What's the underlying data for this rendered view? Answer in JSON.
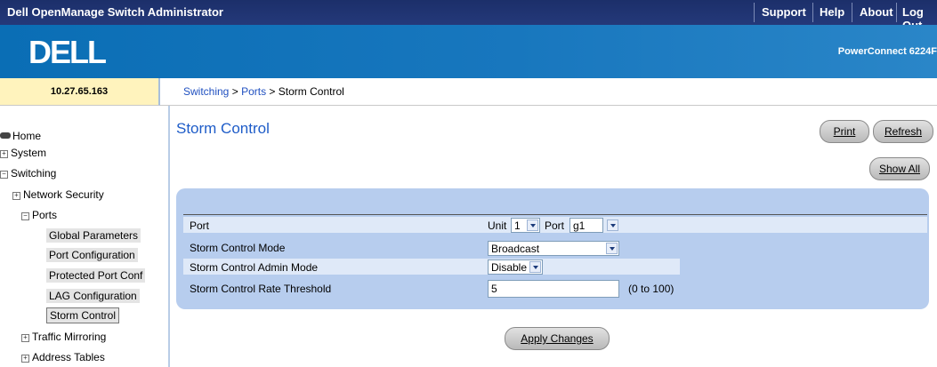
{
  "header": {
    "app_title": "Dell OpenManage Switch Administrator",
    "links": [
      "Support",
      "Help",
      "About",
      "Log Out"
    ]
  },
  "banner": {
    "logo": "DELL",
    "model": "PowerConnect 6224F"
  },
  "ip_address": "10.27.65.163",
  "breadcrumb": {
    "items": [
      "Switching",
      "Ports",
      "Storm Control"
    ],
    "separator": ">"
  },
  "sidebar": {
    "home": "Home",
    "system": "System",
    "switching": "Switching",
    "network_security": "Network Security",
    "ports": "Ports",
    "ports_children": [
      "Global Parameters",
      "Port Configuration",
      "Protected Port Conf",
      "LAG Configuration",
      "Storm Control"
    ],
    "traffic_mirroring": "Traffic Mirroring",
    "address_tables": "Address Tables"
  },
  "page": {
    "title": "Storm Control",
    "print_label": "Print",
    "refresh_label": "Refresh",
    "show_all_label": "Show All",
    "apply_label": "Apply Changes"
  },
  "form": {
    "port_label": "Port",
    "unit_label": "Unit",
    "unit_value": "1",
    "port_sel_label": "Port",
    "port_value": "g1",
    "mode_label": "Storm Control Mode",
    "mode_value": "Broadcast",
    "admin_label": "Storm Control Admin Mode",
    "admin_value": "Disable",
    "rate_label": "Storm Control Rate Threshold",
    "rate_value": "5",
    "rate_hint": "(0 to 100)"
  },
  "colors": {
    "topbar": "#1c2f6a",
    "banner": "#1877be",
    "panel": "#b7cdee",
    "row_highlight": "#dfe9f8",
    "title_blue": "#1e5cc8",
    "link_blue": "#2050c0",
    "ip_box": "#fff3bd"
  }
}
